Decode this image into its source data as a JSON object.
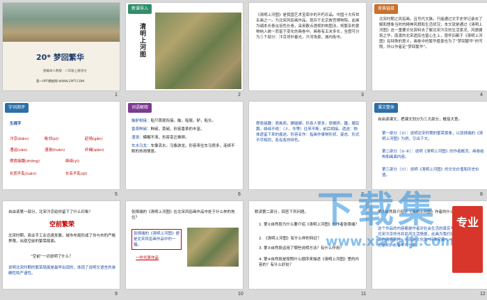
{
  "slide1": {
    "title": "20* 梦回繁华",
    "subtitle": "部编本人教版 · 八年级上册语文",
    "footer": "第一PPT模板网-WWW.1PPT.COM",
    "num": "1"
  },
  "slide2": {
    "header": "新课导入",
    "vert": "清明上河图",
    "num": "2"
  },
  "slide3": {
    "text": "《清明上河图》是我国艺术宝库中的不朽珍品。中国十大传世名画之一。为北宋风俗画作品，现存于北京故宫博物院。此画为绢本长卷淡设色长卷，采用散点透视的构图法，将繁杂的景物纳入统一而富于变化的画卷中。画卷有五米多长，全图可分为三个部分：汴京郊外春光，汴河场景，城内街市。",
    "num": "3"
  },
  "slide4": {
    "header": "背景链接",
    "text": "北宋时期之风俗画，且写代文脉。只能通过文字史学记录去了解和想象当时的精神风貌和生活状况，本文就是通过《清明上河图》这一重要文化资料去了解北宋汴京的生活景况、风貌建筑之华，南渡的北宋遗民也曾心生上，感怀旧都于《清明上河图》有特殊的意义，画卷中的繁华盛景也为了“梦回繁华”的写照，所以作者定“梦回繁华”。",
    "num": "4"
  },
  "slide5": {
    "header": "字词测评",
    "label": "生疏字",
    "words": [
      "汴京(biàn)",
      "毗邻(pí)",
      "鳞次栉比(zhì)",
      "赶场(gǎn)",
      "漕运(cáo)",
      "漫漶(huàn)",
      "纤绳(qiàn)",
      "寂寥(liáo)",
      "摩肩接踵(zhǒng)",
      "络绎(yì)",
      "长而不乱(luàn)",
      "长名不乱(qí)"
    ],
    "num": "5"
  },
  "slide6": {
    "header": "词语解释",
    "items": [
      {
        "term": "舳舻相接：",
        "def": "船只首尾衔接。舳，船尾。舻，船头。"
      },
      {
        "term": "香茶鲜碗：",
        "def": "鲜碗，菜碗，形容香茶的丰富。"
      },
      {
        "term": "漫漶：",
        "def": "模糊不清，形容变迁难辨。"
      },
      {
        "term": "车水马龙：",
        "def": "车像流水，马像游龙。形容来往车马很多，连续不断的热闹情景。"
      }
    ],
    "num": "6"
  },
  "slide7": {
    "text": "摩肩接踵：肩挨肩，脚碰脚。形容人很多，很拥挤。踵，脚后跟。络绎不绝：（人、车等）往来不断，前后相接。遗迹：物体遗留下来的痕迹。形容名作：指画作事物形状、姿态、形式不尽相同，各有各的特色。",
    "num": "7"
  },
  "slide8": {
    "header": "课文整体",
    "intro": "自由读课文，把课文划分为三大部分，概括大意。",
    "parts": [
      "第一部分（①）：说明北宋时期的繁荣景象，以张择端的《清明上河图》为例，引出下文。",
      "第二部分（②-⑥）：说明《清明上河图》的作者概况、画卷结构和画面内容。",
      "第三部分（⑦）：说明《清明上河图》的文化价值和历史价值。"
    ],
    "num": "8"
  },
  "slide9": {
    "q": "自由读第一部分，北宋汴京给你留下了什么印象？",
    "answer": "空前繁荣",
    "text": "北宋时期，商业手工业迅速发展，城市布局形成了坊与市的严格界限，出现空前的繁荣局面。",
    "q2": "“空前”一词说明了什么？",
    "a2": "说明北宋时期的繁荣局面是最早出现的，体现了说明文语言的准确性和严谨性。",
    "num": "9"
  },
  "slide10": {
    "q": "张择端的《清明上河图》在北宋风俗画作品中处于什么样的地位？",
    "box": "张择端的《清明上河图》便是北宋风俗画作品中的一幅。",
    "tag": "一件代表作品",
    "num": "10"
  },
  "slide11": {
    "head": "默读第二部分，回答下列问题。",
    "qs": [
      "1. 第②自然段为什么要介绍《清明上河图》的作者张择端？",
      "2. 《清明上河图》有什么样的特征？",
      "3. 第③自然段运用了哪些说明方法？有什么作用？",
      "4. 第④自然段是按照什么顺序来描述《清明上河图》里的内容的？有什么好处？"
    ],
    "num": "11"
  },
  "slide12": {
    "q": "第⑦自然段介绍了《清明上河图》作者的什么特点？",
    "a": "这个作品的内容都是作者对社会生活的真实写照。文章再现了北宋汴京的市井民风生活情景，此画为我们体会作者体现了作家的情感寄托，也就是文化的“特殊宝藏”，作者作品都具有历史意义，二者不可分离。",
    "num": "12"
  },
  "watermark": {
    "big": "下载集",
    "url": "www.xiazaiji.com",
    "logo": "专业"
  }
}
